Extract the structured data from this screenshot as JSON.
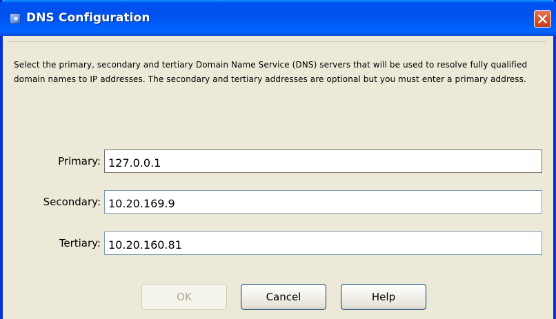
{
  "window": {
    "title": "DNS Configuration",
    "close_icon": "close-icon",
    "app_icon": "app-window-icon"
  },
  "description": "Select the primary, secondary and tertiary Domain Name Service (DNS) servers that will be used to resolve fully qualified domain names to IP addresses. The secondary and tertiary addresses are optional but you must enter a primary address.",
  "fields": {
    "primary": {
      "label": "Primary:",
      "value": "127.0.0.1"
    },
    "secondary": {
      "label": "Secondary:",
      "value": "10.20.169.9"
    },
    "tertiary": {
      "label": "Tertiary:",
      "value": "10.20.160.81"
    }
  },
  "buttons": {
    "ok": {
      "label": "OK",
      "enabled": false
    },
    "cancel": {
      "label": "Cancel",
      "enabled": true
    },
    "help": {
      "label": "Help",
      "enabled": true
    }
  },
  "colors": {
    "title_bar": "#0053ee",
    "close_button": "#d9532e",
    "dialog_background": "#ece9d8"
  }
}
